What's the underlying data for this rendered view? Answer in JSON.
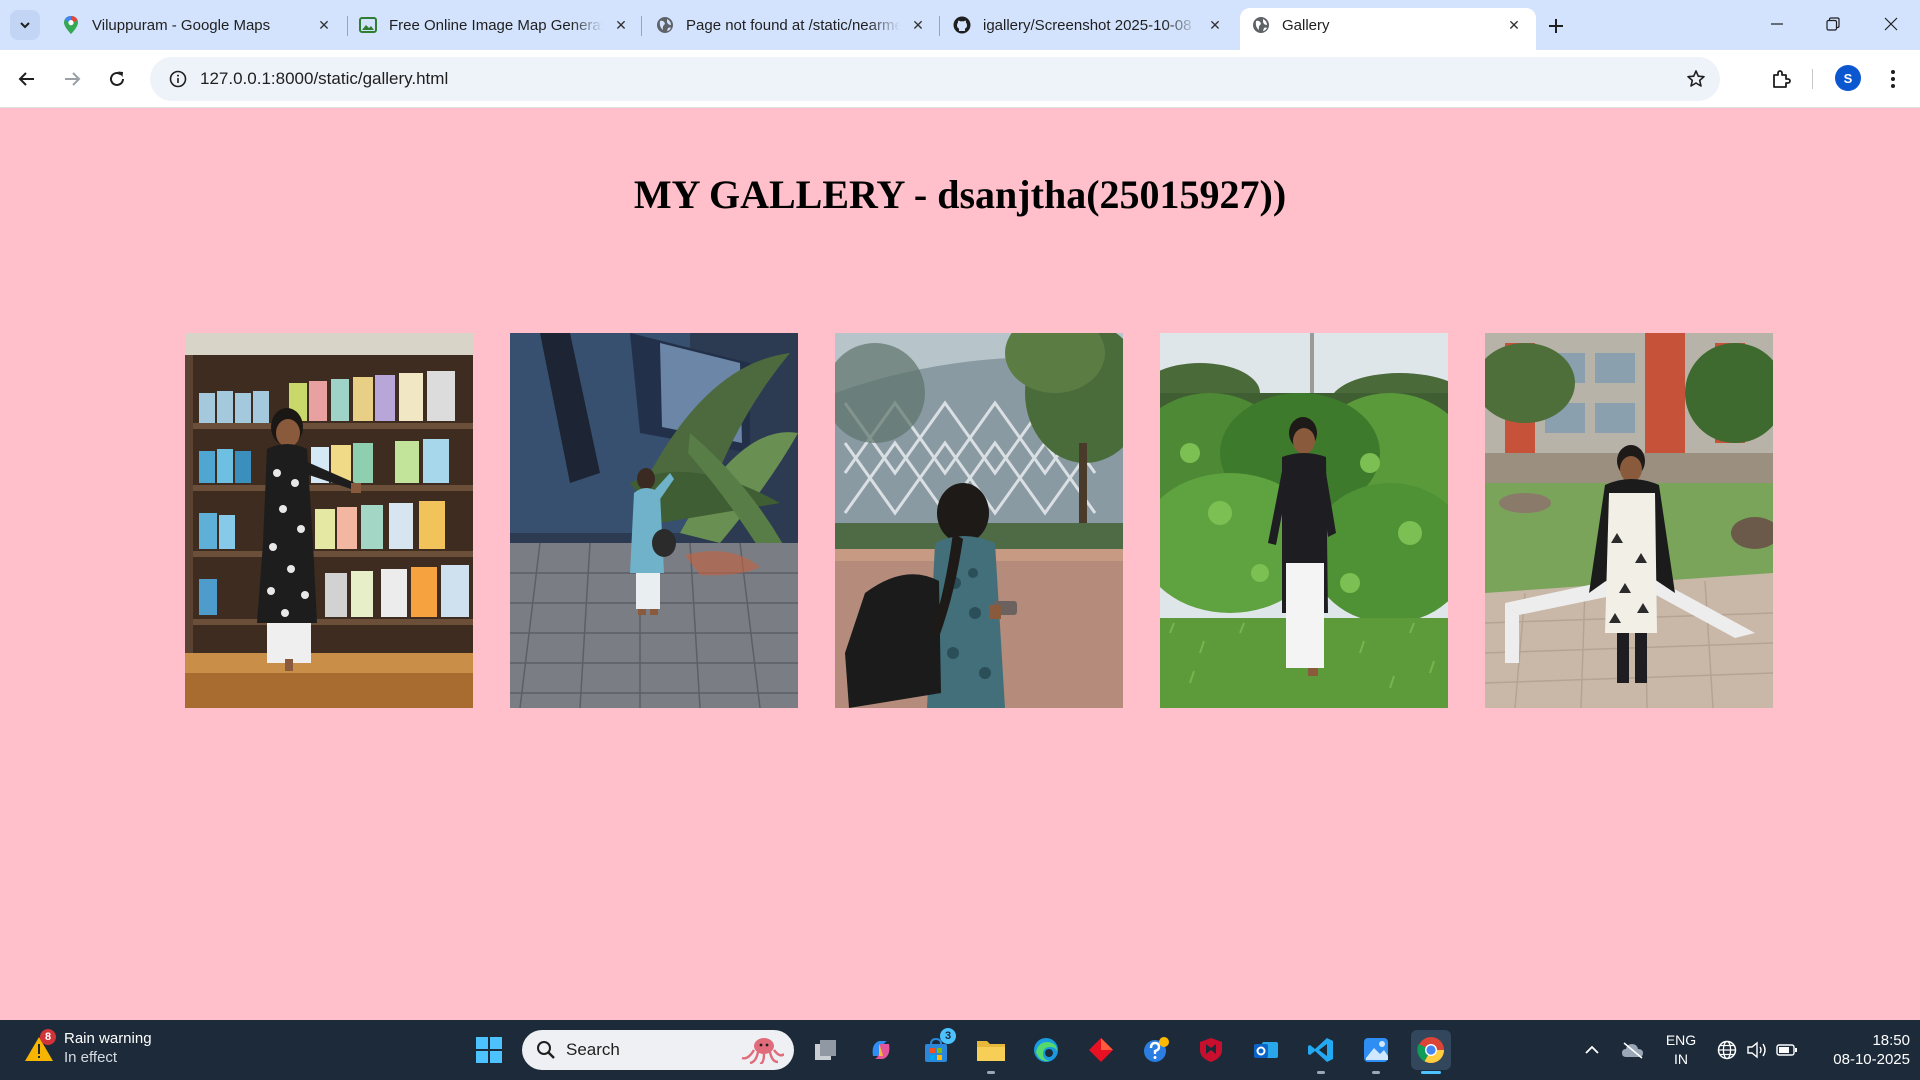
{
  "browser": {
    "tabs": [
      {
        "title": "Viluppuram - Google Maps",
        "icon": "maps-pin-icon"
      },
      {
        "title": "Free Online Image Map Generator",
        "icon": "image-icon"
      },
      {
        "title": "Page not found at /static/nearme",
        "icon": "globe-icon"
      },
      {
        "title": "igallery/Screenshot 2025-10-08",
        "icon": "github-icon"
      },
      {
        "title": "Gallery",
        "icon": "globe-icon",
        "active": true
      }
    ],
    "url": "127.0.0.1:8000/static/gallery.html",
    "profile_initial": "S"
  },
  "page": {
    "title": "MY GALLERY - dsanjtha(25015927))",
    "background": "#ffc0cb",
    "photos": [
      {
        "name": "photo-bookshelf"
      },
      {
        "name": "photo-palm-tree"
      },
      {
        "name": "photo-building"
      },
      {
        "name": "photo-garden"
      },
      {
        "name": "photo-courtyard"
      }
    ]
  },
  "taskbar": {
    "weather_badge": "8",
    "weather_title": "Rain warning",
    "weather_subtitle": "In effect",
    "search_placeholder": "Search",
    "store_badge": "3",
    "lang_1": "ENG",
    "lang_2": "IN",
    "time": "18:50",
    "date": "08-10-2025"
  }
}
